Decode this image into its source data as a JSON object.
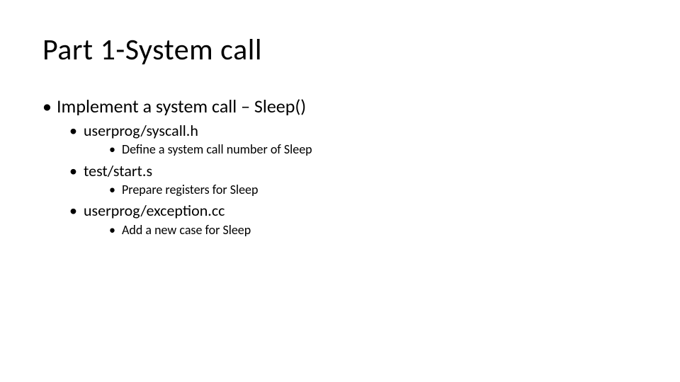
{
  "title": "Part 1-System call",
  "bullets": {
    "lvl1_0": "Implement a system call – Sleep()",
    "lvl2_0": "userprog/syscall.h",
    "lvl3_0": "Define a system call number of Sleep",
    "lvl2_1": "test/start.s",
    "lvl3_1": "Prepare registers for Sleep",
    "lvl2_2": "userprog/exception.cc",
    "lvl3_2": "Add a new case for Sleep"
  }
}
